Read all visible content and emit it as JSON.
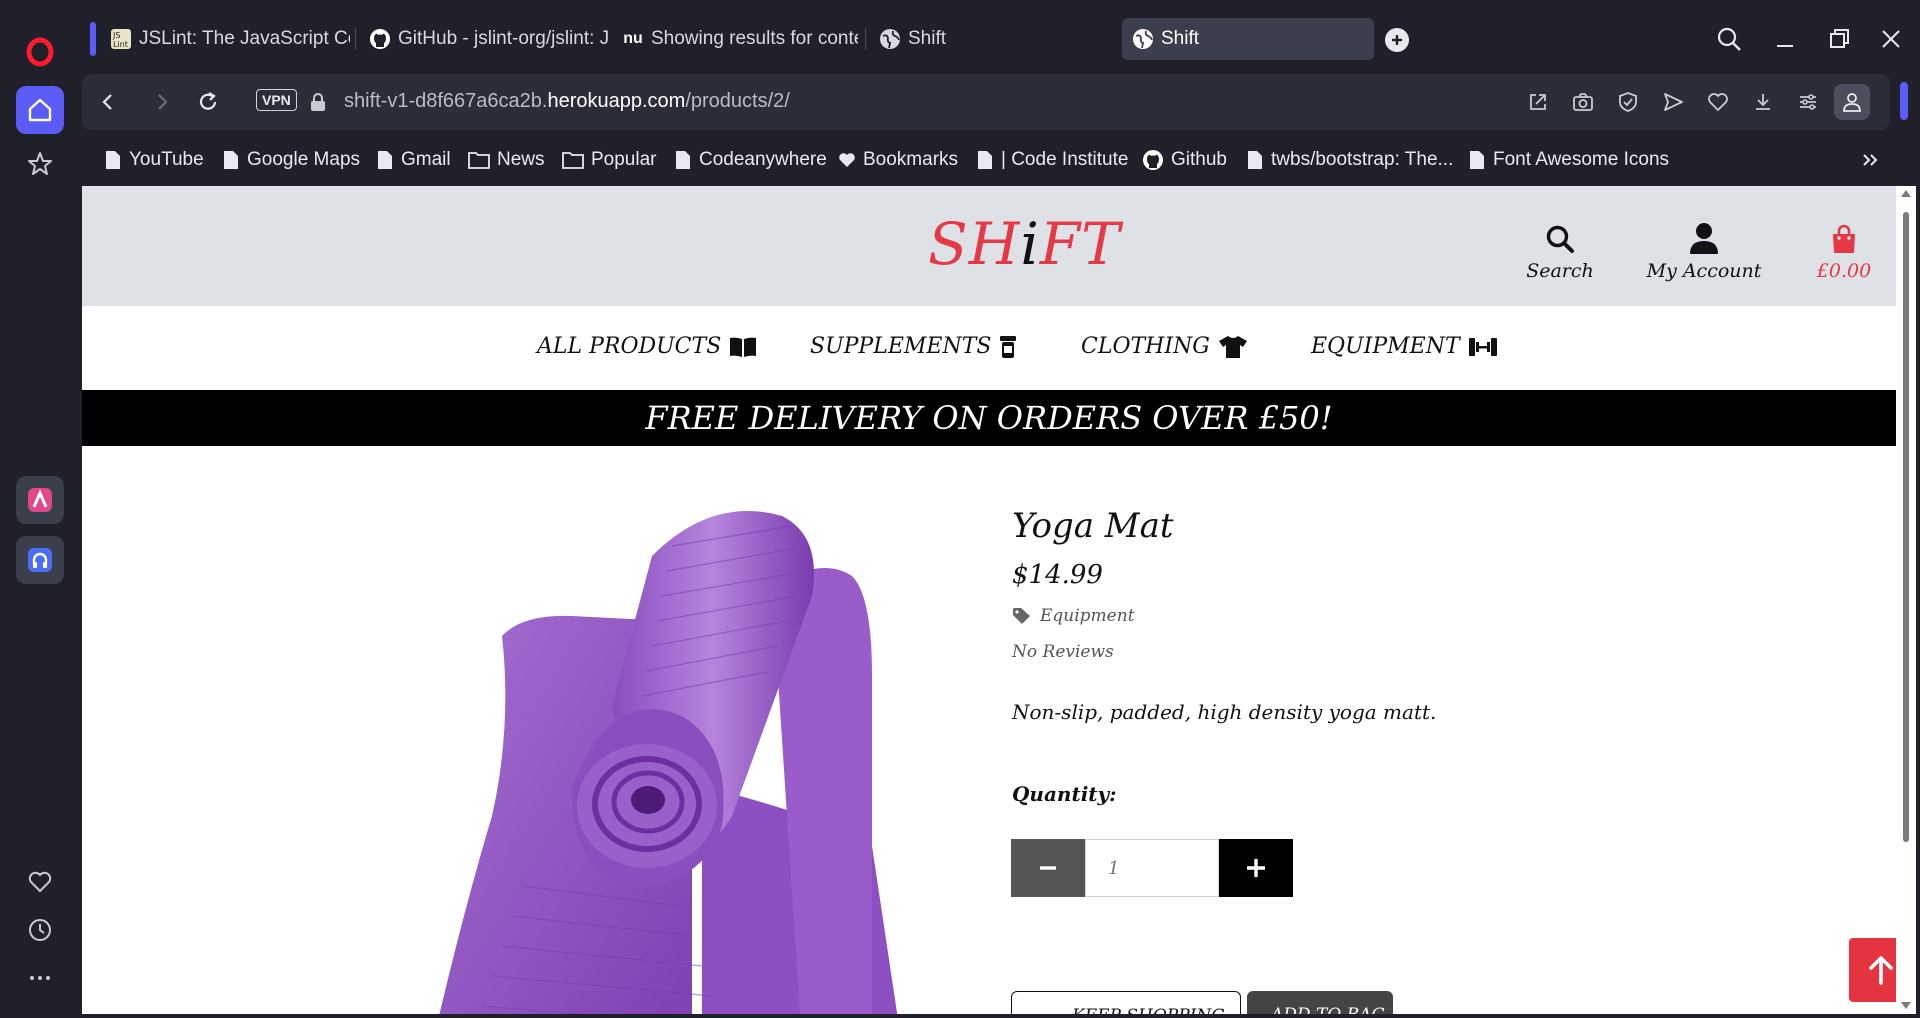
{
  "browser": {
    "tabs": [
      {
        "label": "JSLint: The JavaScript Code Quality Tool",
        "icon": "jslint-icon"
      },
      {
        "label": "GitHub - jslint-org/jslint: JSLint",
        "icon": "github-icon"
      },
      {
        "label": "Showing results for contents",
        "icon": "nu-icon"
      },
      {
        "label": "Shift",
        "icon": "globe-icon"
      },
      {
        "label": "Shift",
        "icon": "globe-icon",
        "active": true
      }
    ],
    "url_prefix": "shift-v1-d8f667a6ca2b.",
    "url_host": "herokuapp.com",
    "url_path": "/products/2/",
    "vpn_label": "VPN",
    "bookmarks": [
      {
        "label": "YouTube",
        "icon": "page-icon"
      },
      {
        "label": "Google Maps",
        "icon": "page-icon"
      },
      {
        "label": "Gmail",
        "icon": "page-icon"
      },
      {
        "label": "News",
        "icon": "folder-icon"
      },
      {
        "label": "Popular",
        "icon": "folder-icon"
      },
      {
        "label": "Codeanywhere",
        "icon": "page-icon"
      },
      {
        "label": "Bookmarks",
        "icon": "heart-icon"
      },
      {
        "label": "| Code Institute",
        "icon": "page-icon"
      },
      {
        "label": "Github",
        "icon": "github-icon"
      },
      {
        "label": "twbs/bootstrap: The...",
        "icon": "page-icon"
      },
      {
        "label": "Font Awesome Icons",
        "icon": "page-icon"
      }
    ],
    "accent": "#5b5bf5"
  },
  "site": {
    "logo_left": "SH",
    "logo_i": "i",
    "logo_right": "FT",
    "header": {
      "search_label": "Search",
      "account_label": "My Account",
      "bag_total": "£0.00"
    },
    "nav": [
      {
        "label": "ALL PRODUCTS",
        "icon": "book-open-icon"
      },
      {
        "label": "SUPPLEMENTS",
        "icon": "prescription-bottle-icon"
      },
      {
        "label": "CLOTHING",
        "icon": "tshirt-icon"
      },
      {
        "label": "EQUIPMENT",
        "icon": "dumbbell-icon"
      }
    ],
    "banner": "FREE DELIVERY ON ORDERS OVER £50!",
    "brand_color": "#e53946"
  },
  "product": {
    "name": "Yoga Mat",
    "price": "$14.99",
    "category": "Equipment",
    "reviews": "No Reviews",
    "description": "Non-slip, padded, high density yoga matt.",
    "quantity_label": "Quantity:",
    "quantity_value": "1",
    "keep_shopping": "KEEP SHOPPING",
    "add_to_bag": "ADD TO BAG",
    "image_color": "#9b59c4"
  }
}
